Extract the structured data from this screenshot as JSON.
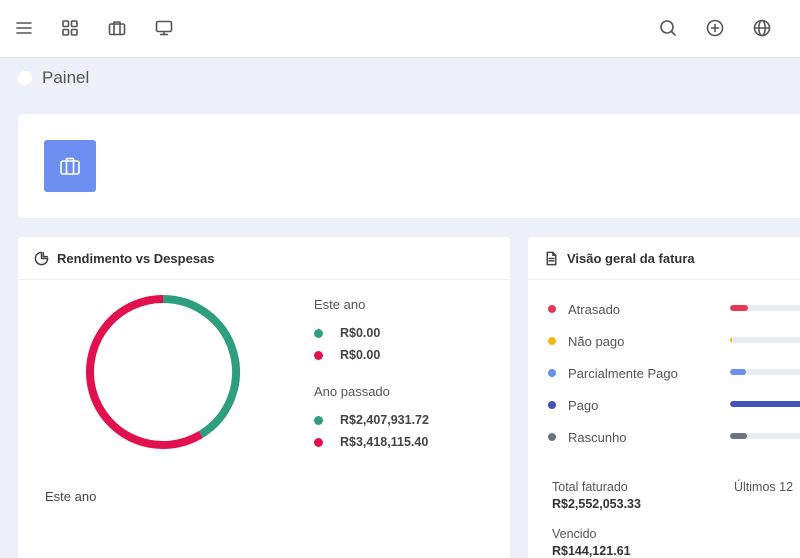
{
  "header": {
    "icons": [
      "menu-icon",
      "grid-icon",
      "briefcase-icon",
      "monitor-icon",
      "search-icon",
      "add-circle-icon",
      "globe-icon"
    ]
  },
  "page": {
    "title": "Painel"
  },
  "income_card": {
    "title": "Rendimento vs Despesas",
    "this_year_label": "Este ano",
    "this_year": [
      {
        "value": "R$0.00",
        "color": "#2e9e7f"
      },
      {
        "value": "R$0.00",
        "color": "#e0114e"
      }
    ],
    "last_year_label": "Ano passado",
    "last_year": [
      {
        "value": "R$2,407,931.72",
        "color": "#2e9e7f"
      },
      {
        "value": "R$3,418,115.40",
        "color": "#e0114e"
      }
    ],
    "footer_label": "Este ano",
    "chart_data": {
      "type": "pie",
      "categories": [
        "Rendimento",
        "Despesas"
      ],
      "values": [
        2407931.72,
        3418115.4
      ],
      "colors": [
        "#2e9e7f",
        "#e0114e"
      ]
    }
  },
  "invoice_card": {
    "title": "Visão geral da fatura",
    "statuses": [
      {
        "label": "Atrasado",
        "color": "#e5395c",
        "fill": 0.18
      },
      {
        "label": "Não pago",
        "color": "#f5b70f",
        "fill": 0.02
      },
      {
        "label": "Parcialmente Pago",
        "color": "#6b8ef0",
        "fill": 0.16
      },
      {
        "label": "Pago",
        "color": "#4451b8",
        "fill": 0.85
      },
      {
        "label": "Rascunho",
        "color": "#6c757d",
        "fill": 0.17
      }
    ],
    "total_label": "Total faturado",
    "total_value": "R$2,552,053.33",
    "period_label": "Últimos 12",
    "due_label": "Vencido",
    "due_value": "R$144,121.61"
  }
}
